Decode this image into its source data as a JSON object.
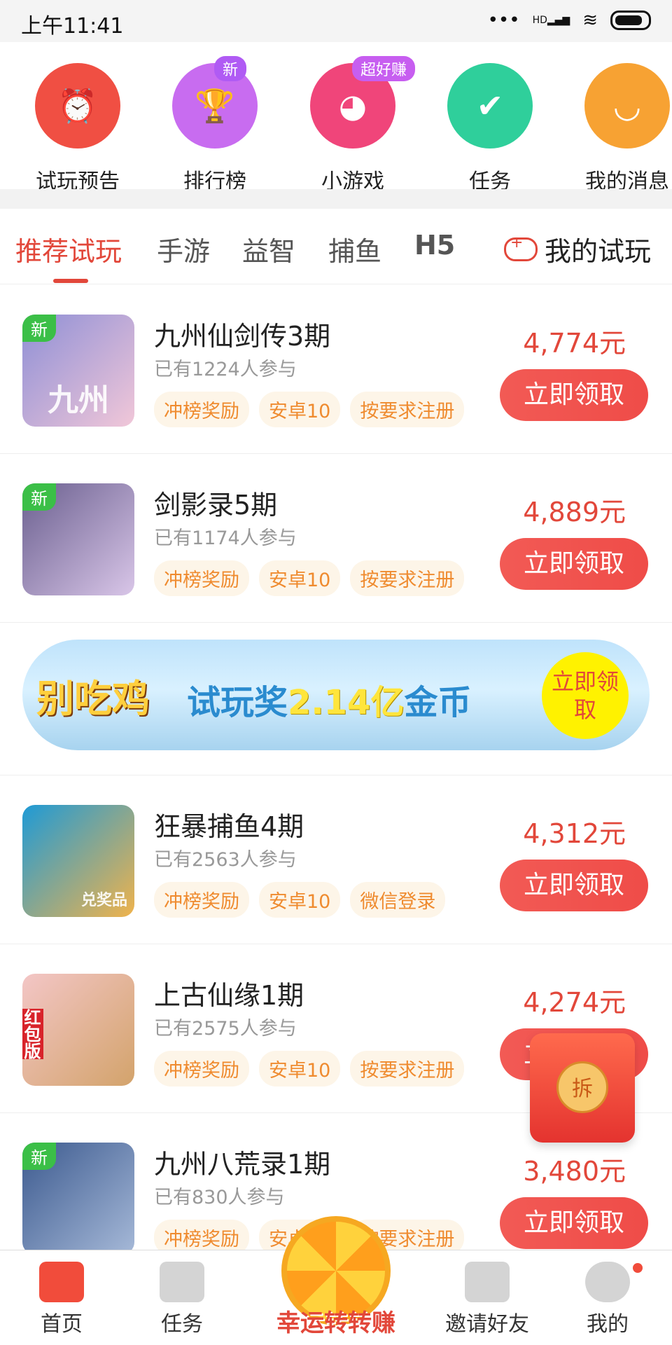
{
  "status_bar": {
    "time": "上午11:41",
    "signal": "HD",
    "icons": [
      "signal-icon",
      "wifi-icon",
      "battery-icon"
    ]
  },
  "quick_actions": [
    {
      "label": "试玩预告",
      "icon": "alarm-clock-icon",
      "color": "#f04f43",
      "badge": ""
    },
    {
      "label": "排行榜",
      "icon": "trophy-icon",
      "color": "#c86cf0",
      "badge": "新"
    },
    {
      "label": "小游戏",
      "icon": "pacman-icon",
      "color": "#f0457a",
      "badge": "超好赚"
    },
    {
      "label": "任务",
      "icon": "calendar-check-icon",
      "color": "#2fcf9b",
      "badge": ""
    },
    {
      "label": "我的消息",
      "icon": "chat-icon",
      "color": "#f7a233",
      "badge": ""
    }
  ],
  "tabs": [
    {
      "label": "推荐试玩",
      "active": true
    },
    {
      "label": "手游",
      "active": false
    },
    {
      "label": "益智",
      "active": false
    },
    {
      "label": "捕鱼",
      "active": false
    },
    {
      "label": "H5",
      "active": false
    }
  ],
  "my_trial": "我的试玩",
  "games": [
    {
      "title": "九州仙剑传3期",
      "participants": "已有1224人参与",
      "tags": [
        "冲榜奖励",
        "安卓10",
        "按要求注册"
      ],
      "price": "4,774元",
      "button": "立即领取",
      "is_new": true,
      "new_label": "新",
      "thumb_text": "九州",
      "thumb_colors": [
        "#8e8fd6",
        "#f1c7d8"
      ]
    },
    {
      "title": "剑影录5期",
      "participants": "已有1174人参与",
      "tags": [
        "冲榜奖励",
        "安卓10",
        "按要求注册"
      ],
      "price": "4,889元",
      "button": "立即领取",
      "is_new": true,
      "new_label": "新",
      "thumb_text": "",
      "thumb_colors": [
        "#6a5f8f",
        "#d9c6e8"
      ]
    },
    {
      "title": "狂暴捕鱼4期",
      "participants": "已有2563人参与",
      "tags": [
        "冲榜奖励",
        "安卓10",
        "微信登录"
      ],
      "price": "4,312元",
      "button": "立即领取",
      "is_new": false,
      "new_label": "",
      "thumb_text": "兑奖品",
      "thumb_colors": [
        "#1e9ad6",
        "#f0b34c"
      ]
    },
    {
      "title": "上古仙缘1期",
      "participants": "已有2575人参与",
      "tags": [
        "冲榜奖励",
        "安卓10",
        "按要求注册"
      ],
      "price": "4,274元",
      "button": "立即领取",
      "is_new": false,
      "new_label": "",
      "thumb_text": "红包版",
      "thumb_colors": [
        "#f3c6c6",
        "#d3a36b"
      ]
    },
    {
      "title": "九州八荒录1期",
      "participants": "已有830人参与",
      "tags": [
        "冲榜奖励",
        "安卓10",
        "按要求注册"
      ],
      "price": "3,480元",
      "button": "立即领取",
      "is_new": true,
      "new_label": "新",
      "thumb_text": "",
      "thumb_colors": [
        "#3c5a8f",
        "#a6b9d8"
      ]
    }
  ],
  "banner": {
    "logo": "别吃鸡",
    "slogan_prefix": "试玩奖",
    "slogan_highlight": "2.14亿",
    "slogan_suffix": "金币",
    "cta": "立即领取"
  },
  "floating_packet": {
    "label": "拆"
  },
  "bottom_nav": [
    {
      "label": "首页",
      "icon": "home-icon",
      "active": true
    },
    {
      "label": "任务",
      "icon": "task-icon",
      "active": false
    },
    {
      "label": "幸运转转赚",
      "icon": "lucky-wheel-icon",
      "active": false
    },
    {
      "label": "邀请好友",
      "icon": "invite-icon",
      "active": false
    },
    {
      "label": "我的",
      "icon": "profile-icon",
      "active": false
    }
  ]
}
